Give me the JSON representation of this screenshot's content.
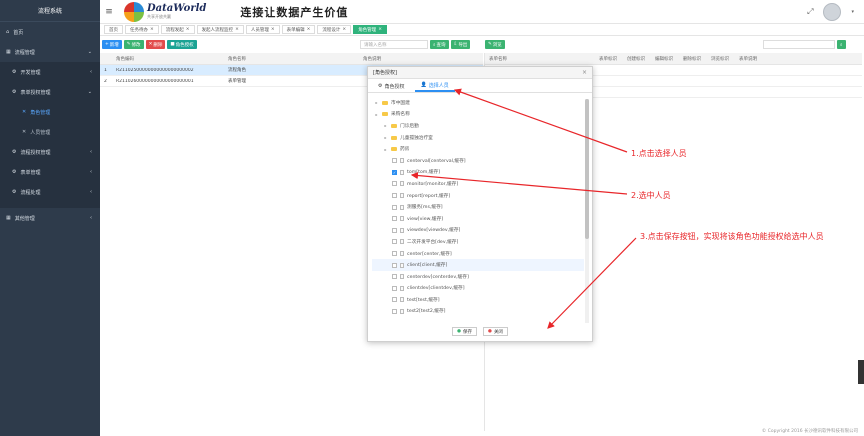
{
  "app": {
    "title": "流程系统"
  },
  "sidebar": {
    "home": "首页",
    "items": [
      {
        "label": "流程管理"
      },
      {
        "label": "开发管理"
      },
      {
        "label": "表单授权管理"
      },
      {
        "label": "角色管理"
      },
      {
        "label": "人员管理"
      },
      {
        "label": "流程授权管理"
      },
      {
        "label": "表单管理"
      },
      {
        "label": "流程处理"
      },
      {
        "label": "其他管理"
      }
    ]
  },
  "header": {
    "logo_text": "DataWorld",
    "logo_sub": "共享开放共赢",
    "slogan": "连接让数据产生价值"
  },
  "tabs": [
    "首页",
    "任务待办",
    "流程发起",
    "发起人流程监控",
    "人员管理",
    "表单编辑",
    "流程设计",
    "角色管理"
  ],
  "left_toolbar": {
    "add": "新增",
    "edit": "修改",
    "delete": "删除",
    "auth": "角色授权"
  },
  "left_table": {
    "headers": [
      "角色编码",
      "角色名称",
      "角色说明"
    ],
    "rows": [
      {
        "no": "1",
        "code": "R21102500000000000000000002",
        "name": "流程角色"
      },
      {
        "no": "2",
        "code": "R21102600000000000000000001",
        "name": "表单管理"
      }
    ]
  },
  "mid_toolbar": {
    "search_placeholder": "请输入名称",
    "search": "查询",
    "export": "导出"
  },
  "right_toolbar": {
    "view": "浏览"
  },
  "right_table": {
    "headers": [
      "表单名称",
      "表单标识",
      "创建标识",
      "编辑标识",
      "删除标识",
      "浏览标识",
      "表单说明"
    ]
  },
  "modal": {
    "title": "[角色授权]",
    "tab_role": "角色授权",
    "tab_person": "选择人员",
    "tree": [
      {
        "label": "市中国建",
        "type": "folder",
        "level": 0
      },
      {
        "label": "采购名称",
        "type": "folder",
        "level": 0
      },
      {
        "label": "门诊后勤",
        "type": "folder",
        "level": 1
      },
      {
        "label": "儿童孤独治疗室",
        "type": "folder",
        "level": 1
      },
      {
        "label": "药房",
        "type": "folder",
        "level": 1
      },
      {
        "label": "centerval[centerval,缓存]",
        "type": "user",
        "level": 2,
        "checked": false
      },
      {
        "label": "tom[tom,缓存]",
        "type": "user",
        "level": 2,
        "checked": true
      },
      {
        "label": "monitor[monitor,缓存]",
        "type": "user",
        "level": 2,
        "checked": false
      },
      {
        "label": "report[report,缓存]",
        "type": "user",
        "level": 2,
        "checked": false
      },
      {
        "label": "测服务[ms,缓存]",
        "type": "user",
        "level": 2,
        "checked": false
      },
      {
        "label": "view[view,缓存]",
        "type": "user",
        "level": 2,
        "checked": false
      },
      {
        "label": "viewdev[viewdev,缓存]",
        "type": "user",
        "level": 2,
        "checked": false
      },
      {
        "label": "二次开发平台[dev,缓存]",
        "type": "user",
        "level": 2,
        "checked": false
      },
      {
        "label": "center[center,缓存]",
        "type": "user",
        "level": 2,
        "checked": false
      },
      {
        "label": "client[client,缓存]",
        "type": "user",
        "level": 2,
        "checked": false
      },
      {
        "label": "centerdev[centerdev,缓存]",
        "type": "user",
        "level": 2,
        "checked": false
      },
      {
        "label": "clientdev[clientdev,缓存]",
        "type": "user",
        "level": 2,
        "checked": false
      },
      {
        "label": "test[test,缓存]",
        "type": "user",
        "level": 2,
        "checked": false
      },
      {
        "label": "test2[test2,缓存]",
        "type": "user",
        "level": 2,
        "checked": false
      }
    ],
    "save": "保存",
    "close": "关闭"
  },
  "annotations": [
    "1.点击选择人员",
    "2.选中人员",
    "3.点击保存按钮，实现将该角色功能授权给选中人员"
  ],
  "footer": "© Copyright 2016 长沙德讯软件科技有限公司",
  "colors": {
    "sidebar": "#2e3b4b",
    "accent": "#2c8ff2",
    "annotation": "#e8262a",
    "active_tab": "#2fb37c"
  }
}
